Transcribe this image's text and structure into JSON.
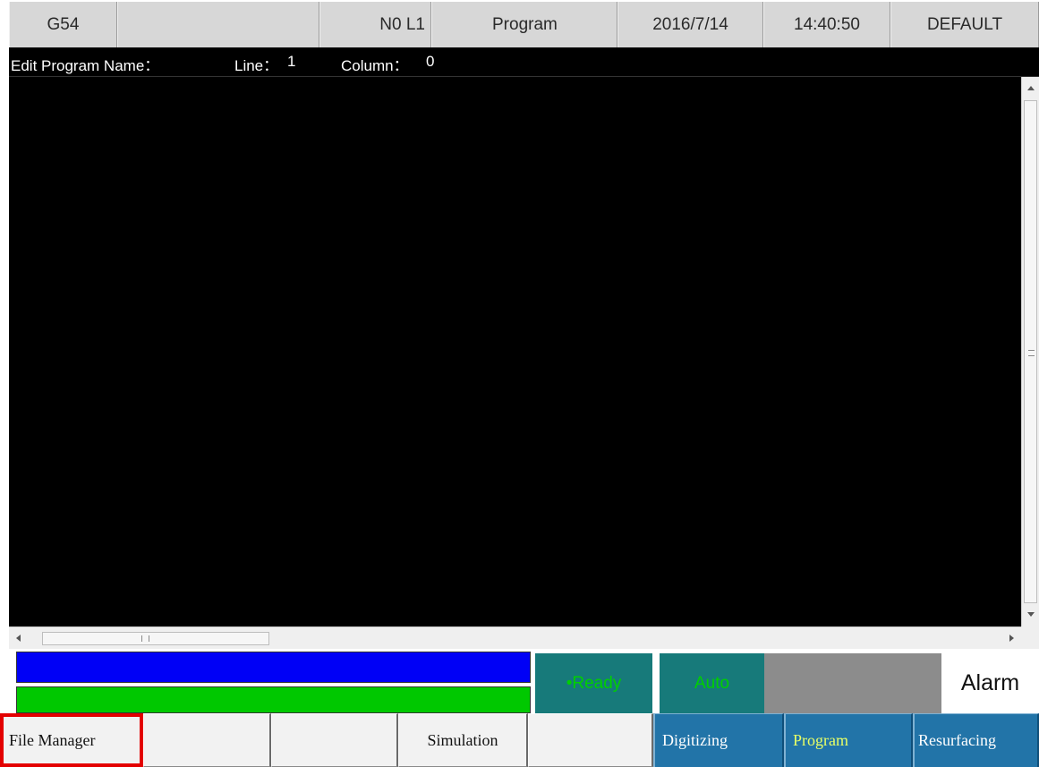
{
  "topbar": {
    "coord_system": "G54",
    "blank": "",
    "line_counter": "N0 L1",
    "mode": "Program",
    "date": "2016/7/14",
    "time": "14:40:50",
    "profile": "DEFAULT"
  },
  "infobar": {
    "program_name_label": "Edit Program Name：",
    "line_label": "Line：",
    "line_value": "1",
    "column_label": "Column：",
    "column_value": "0"
  },
  "editor": {
    "content": ""
  },
  "scrollbars": {
    "vertical_grip": "≡",
    "horizontal_grip": "III"
  },
  "status": {
    "ready": "•Ready",
    "auto": "Auto",
    "alarm": "Alarm",
    "colors": {
      "progress_blue": "#0000f6",
      "progress_green": "#00c800",
      "status_bg": "#177a7a",
      "status_text": "#00d000"
    }
  },
  "function_keys": [
    {
      "label": "File Manager",
      "style": "light",
      "highlighted": true
    },
    {
      "label": "",
      "style": "light"
    },
    {
      "label": "",
      "style": "light"
    },
    {
      "label": "Simulation",
      "style": "light"
    },
    {
      "label": "",
      "style": "light"
    },
    {
      "label": "Digitizing",
      "style": "blue"
    },
    {
      "label": "Program",
      "style": "blue",
      "text_color": "#e8ff66"
    },
    {
      "label": "Resurfacing",
      "style": "blue"
    }
  ],
  "highlight_color": "#e30000"
}
